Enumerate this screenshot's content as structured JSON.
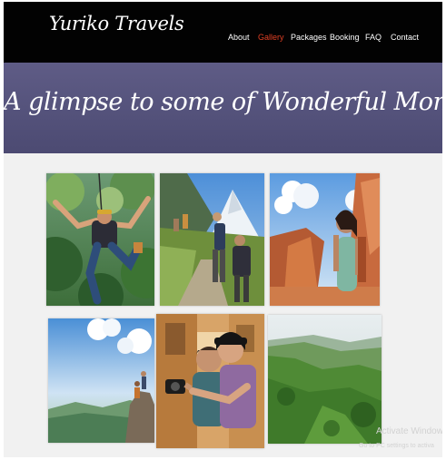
{
  "brand": {
    "logo": "Yuriko Travels"
  },
  "nav": {
    "items": [
      {
        "label": "About"
      },
      {
        "label": "Gallery",
        "active": true
      },
      {
        "label": "Packages"
      },
      {
        "label": "Booking"
      },
      {
        "label": "FAQ"
      },
      {
        "label": "Contact"
      }
    ]
  },
  "hero": {
    "title": "A glimpse to some of Wonderful Moments"
  },
  "gallery": {
    "photos": [
      {
        "name": "zipline-jungle-photo"
      },
      {
        "name": "mountain-hikers-photo"
      },
      {
        "name": "canyon-hiker-woman-photo"
      },
      {
        "name": "cliff-viewpoint-photo"
      },
      {
        "name": "couple-selfie-photo"
      },
      {
        "name": "green-hills-photo"
      }
    ]
  },
  "watermark": {
    "title": "Activate Windows",
    "subtitle": "Go to PC settings to activa"
  },
  "colors": {
    "navbar": "#020202",
    "hero": "#57547e",
    "active_nav": "#e04024",
    "page_bg": "#f1f1f1"
  }
}
